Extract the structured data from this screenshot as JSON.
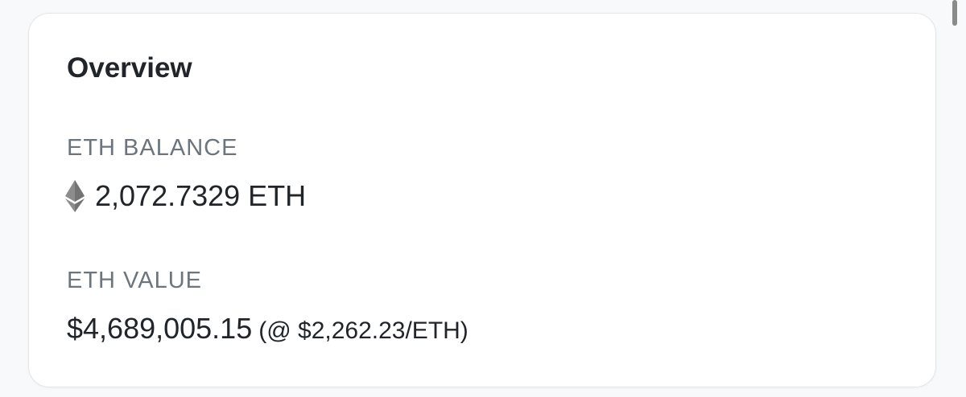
{
  "overview": {
    "title": "Overview",
    "eth_balance": {
      "label": "ETH BALANCE",
      "icon": "ethereum-icon",
      "value": "2,072.7329 ETH"
    },
    "eth_value": {
      "label": "ETH VALUE",
      "value": "$4,689,005.15",
      "rate": "(@ $2,262.23/ETH)"
    }
  },
  "colors": {
    "page_background": "#f8f9fa",
    "card_background": "#ffffff",
    "primary_text": "#212529",
    "muted_text": "#6c757d",
    "eth_icon": "#8c8c8c"
  }
}
